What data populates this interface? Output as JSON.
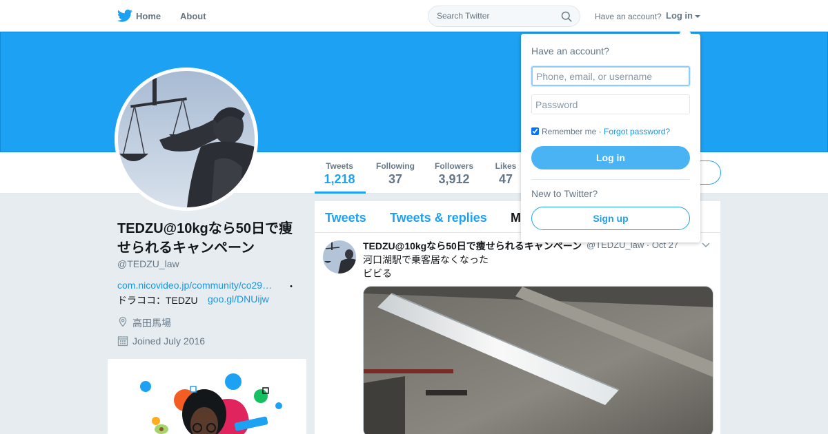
{
  "topbar": {
    "nav": [
      {
        "label": "Home",
        "icon": "twitter-bird-icon"
      },
      {
        "label": "About"
      }
    ],
    "search": {
      "placeholder": "Search Twitter",
      "icon": "search-icon"
    },
    "have_account": "Have an account?",
    "login_label": "Log in"
  },
  "colors": {
    "brand": "#1da1f2",
    "banner": "#1da1f2",
    "link": "#1b95e0",
    "button": "#4ab3f4"
  },
  "profile": {
    "name": "TEDZU@10kgなら50日で痩せられるキャンペーン",
    "handle": "@TEDZU_law",
    "bio_link": "com.nicovideo.jp/community/co29…",
    "bio_separator": "・",
    "bio_text": "ドラココ：TEDZU",
    "bio_short_link": "goo.gl/DNUijw",
    "location": "高田馬場",
    "joined": "Joined July 2016"
  },
  "stats": [
    {
      "label": "Tweets",
      "value": "1,218",
      "active": true
    },
    {
      "label": "Following",
      "value": "37"
    },
    {
      "label": "Followers",
      "value": "3,912"
    },
    {
      "label": "Likes",
      "value": "47"
    }
  ],
  "timeline": {
    "tabs": [
      "Tweets",
      "Tweets & replies",
      "M"
    ],
    "tweet": {
      "name": "TEDZU@10kgなら50日で痩せられるキャンペーン",
      "handle_time": "@TEDZU_law · Oct 27",
      "lines": [
        "河口湖駅で乗客居なくなった",
        "ビビる"
      ]
    }
  },
  "login_dropdown": {
    "title": "Have an account?",
    "username_placeholder": "Phone, email, or username",
    "password_placeholder": "Password",
    "remember": "Remember me",
    "separator": " · ",
    "forgot": "Forgot password?",
    "login_button": "Log in",
    "new_to_twitter": "New to Twitter?",
    "signup_button": "Sign up"
  }
}
